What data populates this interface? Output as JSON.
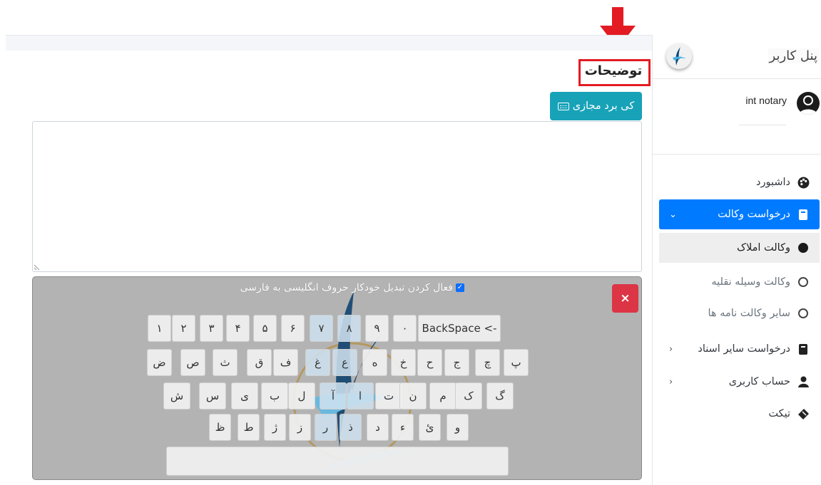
{
  "sidebar": {
    "title": "پنل کاربر",
    "user_name": "int notary",
    "items": [
      {
        "label": "داشبورد"
      },
      {
        "label": "درخواست وکالت",
        "chevron": "⌄"
      },
      {
        "label": "وکالت املاک"
      },
      {
        "label": "وکالت وسیله نقلیه"
      },
      {
        "label": "سایر وکالت نامه ها"
      },
      {
        "label": "درخواست سایر اسناد",
        "chevron": "›"
      },
      {
        "label": "حساب کاربری",
        "chevron": "›"
      },
      {
        "label": "تیکت"
      }
    ]
  },
  "main": {
    "section_title": "توضیحات",
    "virtual_keyboard_button": "کی برد مجازی",
    "textarea_value": ""
  },
  "keyboard": {
    "toggle_label": "فعال کردن تبدیل خودکار حروف انگلیسی به فارسی",
    "toggle_checked": true,
    "close_icon": "×",
    "row1": [
      "١",
      "٢",
      "٣",
      "۴",
      "۵",
      "۶",
      "٧",
      "٨",
      "٩",
      "٠"
    ],
    "backspace": "BackSpace <-",
    "row2": [
      "ض",
      "ص",
      "ث",
      "ق",
      "ف",
      "غ",
      "ع",
      "ه",
      "خ",
      "ح",
      "ج",
      "چ",
      "پ"
    ],
    "row3": [
      "ش",
      "س",
      "ی",
      "ب",
      "ل",
      "آ",
      "ا",
      "ت",
      "ن",
      "م",
      "ک",
      "گ"
    ],
    "row4": [
      "ظ",
      "ط",
      "ژ",
      "ز",
      "ر",
      "ذ",
      "د",
      "ء",
      "ئ",
      "و"
    ],
    "space": ""
  },
  "colors": {
    "accent_blue": "#007bff",
    "teal": "#17a2b8",
    "danger": "#dc3545",
    "highlight_border": "#e31b23"
  }
}
